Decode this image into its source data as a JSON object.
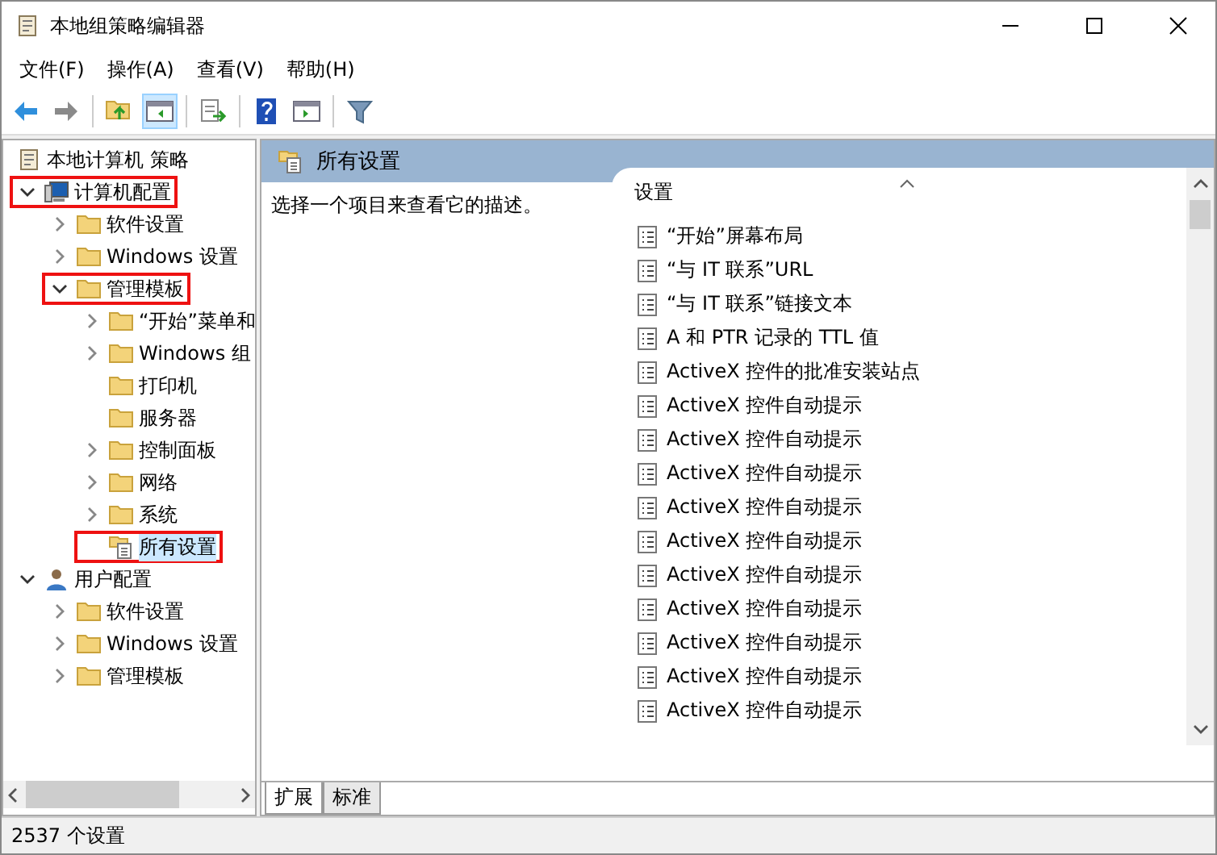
{
  "window": {
    "title": "本地组策略编辑器"
  },
  "menu": [
    "文件(F)",
    "操作(A)",
    "查看(V)",
    "帮助(H)"
  ],
  "toolbar": [
    [
      {
        "kind": "back",
        "pressed": false
      },
      {
        "kind": "forward",
        "pressed": false
      }
    ],
    [
      {
        "kind": "up",
        "pressed": false
      },
      {
        "kind": "tree",
        "pressed": true
      }
    ],
    [
      {
        "kind": "export",
        "pressed": false
      }
    ],
    [
      {
        "kind": "help",
        "pressed": false
      },
      {
        "kind": "action",
        "pressed": false
      }
    ],
    [
      {
        "kind": "filter",
        "pressed": false
      }
    ]
  ],
  "tree": [
    {
      "label": "本地计算机 策略",
      "kind": "policy",
      "selected": false,
      "highlighted": false,
      "children": [
        {
          "label": "计算机配置",
          "kind": "computer",
          "expanded": true,
          "selected": false,
          "highlighted": true,
          "children": [
            {
              "label": "软件设置",
              "kind": "folder",
              "expanded": false,
              "selected": false,
              "highlighted": false
            },
            {
              "label": "Windows 设置",
              "kind": "folder",
              "expanded": false,
              "selected": false,
              "highlighted": false
            },
            {
              "label": "管理模板",
              "kind": "folder",
              "expanded": true,
              "selected": false,
              "highlighted": true,
              "children": [
                {
                  "label": "“开始”菜单和",
                  "kind": "folder",
                  "expanded": false,
                  "selected": false,
                  "highlighted": false
                },
                {
                  "label": "Windows 组",
                  "kind": "folder",
                  "expanded": false,
                  "selected": false,
                  "highlighted": false
                },
                {
                  "label": "打印机",
                  "kind": "folder",
                  "selected": false,
                  "highlighted": false
                },
                {
                  "label": "服务器",
                  "kind": "folder",
                  "selected": false,
                  "highlighted": false
                },
                {
                  "label": "控制面板",
                  "kind": "folder",
                  "expanded": false,
                  "selected": false,
                  "highlighted": false
                },
                {
                  "label": "网络",
                  "kind": "folder",
                  "expanded": false,
                  "selected": false,
                  "highlighted": false
                },
                {
                  "label": "系统",
                  "kind": "folder",
                  "expanded": false,
                  "selected": false,
                  "highlighted": false
                },
                {
                  "label": "所有设置",
                  "kind": "settings",
                  "selected": true,
                  "highlighted": true
                }
              ]
            }
          ]
        },
        {
          "label": "用户配置",
          "kind": "user",
          "expanded": true,
          "selected": false,
          "highlighted": false,
          "children": [
            {
              "label": "软件设置",
              "kind": "folder",
              "expanded": false,
              "selected": false,
              "highlighted": false
            },
            {
              "label": "Windows 设置",
              "kind": "folder",
              "expanded": false,
              "selected": false,
              "highlighted": false
            },
            {
              "label": "管理模板",
              "kind": "folder",
              "expanded": false,
              "selected": false,
              "highlighted": false
            }
          ]
        }
      ]
    }
  ],
  "details": {
    "title": "所有设置",
    "description": "选择一个项目来查看它的描述。",
    "column": "设置",
    "settings": [
      "“开始”屏幕布局",
      "“与 IT 联系”URL",
      "“与 IT 联系”链接文本",
      "A 和 PTR 记录的 TTL 值",
      "ActiveX 控件的批准安装站点",
      "ActiveX 控件自动提示",
      "ActiveX 控件自动提示",
      "ActiveX 控件自动提示",
      "ActiveX 控件自动提示",
      "ActiveX 控件自动提示",
      "ActiveX 控件自动提示",
      "ActiveX 控件自动提示",
      "ActiveX 控件自动提示",
      "ActiveX 控件自动提示",
      "ActiveX 控件自动提示"
    ],
    "tabs": [
      {
        "label": "扩展",
        "selected": true
      },
      {
        "label": "标准",
        "selected": false
      }
    ]
  },
  "status_bar": "2537 个设置"
}
